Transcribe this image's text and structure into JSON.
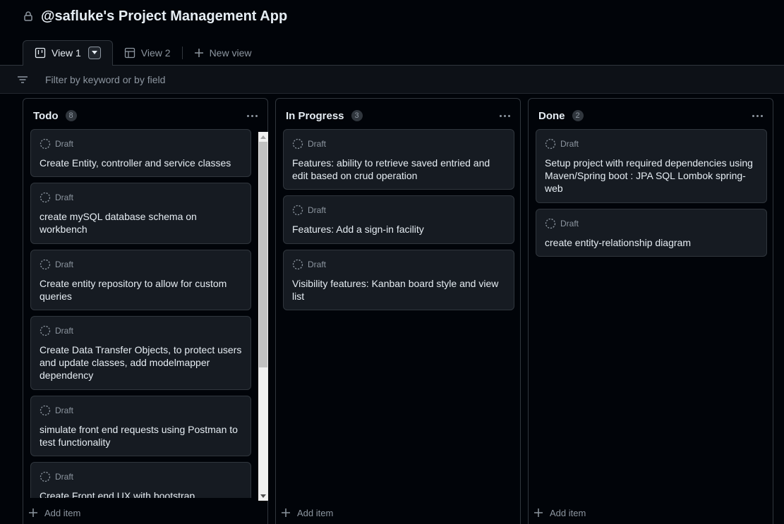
{
  "app": {
    "title": "@safluke's Project Management App"
  },
  "tabs": [
    {
      "label": "View 1",
      "icon": "board-icon",
      "active": true
    },
    {
      "label": "View 2",
      "icon": "table-icon",
      "active": false
    },
    {
      "label": "New view",
      "icon": "plus-icon",
      "active": false
    }
  ],
  "filter": {
    "placeholder": "Filter by keyword or by field"
  },
  "columns": [
    {
      "title": "Todo",
      "count": "8",
      "add_label": "Add item",
      "cards": [
        {
          "status": "Draft",
          "title": "Create Entity, controller and service classes"
        },
        {
          "status": "Draft",
          "title": "create mySQL database schema on workbench"
        },
        {
          "status": "Draft",
          "title": "Create entity repository to allow for custom queries"
        },
        {
          "status": "Draft",
          "title": "Create Data Transfer Objects, to protect users and update classes, add modelmapper dependency"
        },
        {
          "status": "Draft",
          "title": "simulate front end requests using Postman to test functionality"
        },
        {
          "status": "Draft",
          "title": "Create Front end UX with bootstrap"
        }
      ]
    },
    {
      "title": "In Progress",
      "count": "3",
      "add_label": "Add item",
      "cards": [
        {
          "status": "Draft",
          "title": "Features: ability to retrieve saved entried and edit based on crud operation"
        },
        {
          "status": "Draft",
          "title": "Features: Add a sign-in facility"
        },
        {
          "status": "Draft",
          "title": "Visibility features: Kanban board style and view list"
        }
      ]
    },
    {
      "title": "Done",
      "count": "2",
      "add_label": "Add item",
      "cards": [
        {
          "status": "Draft",
          "title": "Setup project with required dependencies using Maven/Spring boot : JPA SQL Lombok spring-web"
        },
        {
          "status": "Draft",
          "title": "create entity-relationship diagram"
        }
      ]
    }
  ],
  "colors": {
    "background": "#010409",
    "card": "#161b22",
    "border": "#30363d",
    "text": "#e6edf3",
    "muted": "#8d96a0"
  }
}
